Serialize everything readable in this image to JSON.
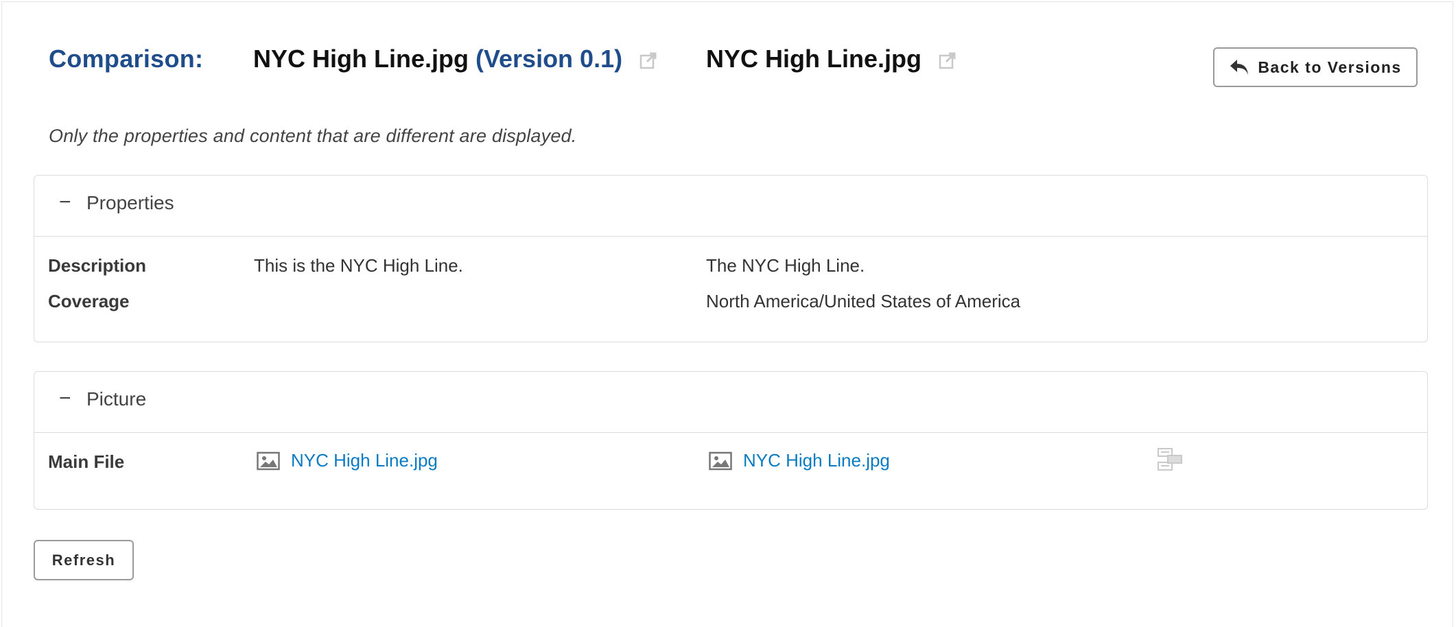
{
  "header": {
    "comparison_label": "Comparison:",
    "left_doc": {
      "name": "NYC High Line.jpg",
      "version": "(Version 0.1)",
      "open_icon": "external-link-icon"
    },
    "right_doc": {
      "name": "NYC High Line.jpg",
      "open_icon": "external-link-icon"
    },
    "back_button": {
      "label": "Back to Versions",
      "icon": "reply-arrow-icon"
    }
  },
  "note": "Only the properties and content that are different are displayed.",
  "properties_panel": {
    "toggle": "−",
    "title": "Properties",
    "rows": [
      {
        "label": "Description",
        "left": "This is the NYC High Line.",
        "right": "The NYC High Line."
      },
      {
        "label": "Coverage",
        "left": "",
        "right": "North America/United States of America"
      }
    ]
  },
  "picture_panel": {
    "toggle": "−",
    "title": "Picture",
    "rows": [
      {
        "label": "Main File",
        "left_file": "NYC High Line.jpg",
        "right_file": "NYC High Line.jpg",
        "file_icon": "image-file-icon",
        "compare_icon": "compare-diff-icon"
      }
    ]
  },
  "refresh_button": {
    "label": "Refresh"
  },
  "colors": {
    "accent": "#1f4c8a",
    "link": "#0a7bc2",
    "border": "#dcdcdc"
  }
}
